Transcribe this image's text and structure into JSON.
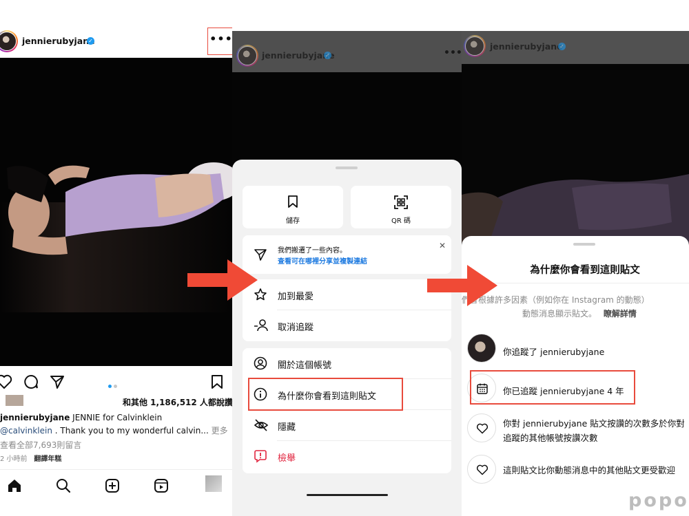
{
  "panel1": {
    "username": "jennierubyjane",
    "more_label": "•••",
    "likes_text": "和其他 1,186,512 人都說讚",
    "caption_user": "jennierubyjane",
    "caption_text": " JENNIE for Calvinklein",
    "mention": "@calvinklein",
    "caption_rest": " . Thank you to my wonderful calvin...",
    "more_link": "更多",
    "view_comments": "查看全部7,693則留言",
    "time_ago": "2 小時前",
    "translate": "翻譯年糕"
  },
  "panel2": {
    "username": "jennierubyjane",
    "tiles": [
      {
        "label": "儲存",
        "icon": "bookmark-icon"
      },
      {
        "label": "QR 碼",
        "icon": "qr-code-icon"
      }
    ],
    "notice": {
      "line1": "我們搬遷了一些內容。",
      "line2": "查看可在哪裡分享並複製連結",
      "close": "✕"
    },
    "group1": [
      {
        "label": "加到最愛",
        "icon": "star-icon"
      },
      {
        "label": "取消追蹤",
        "icon": "unfollow-icon"
      }
    ],
    "group2": [
      {
        "label": "關於這個帳號",
        "icon": "account-icon"
      },
      {
        "label": "為什麼你會看到這則貼文",
        "icon": "info-icon"
      },
      {
        "label": "隱藏",
        "icon": "hide-icon"
      },
      {
        "label": "檢舉",
        "icon": "report-icon"
      }
    ],
    "accent_danger": "#e1253f"
  },
  "panel3": {
    "username": "jennierubyjane",
    "title": "為什麼你會看到這則貼文",
    "desc_line1": "們會根據許多因素（例如你在 Instagram 的動態）",
    "desc_line2": "動態消息顯示貼文。",
    "learn_more": "瞭解詳情",
    "reasons": [
      {
        "text": "你追蹤了 jennierubyjane",
        "icon": "avatar"
      },
      {
        "text": "你已追蹤 jennierubyjane 4 年",
        "icon": "calendar-icon"
      },
      {
        "text": "你對 jennierubyjane 貼文按讚的次數多於你對",
        "text2": "追蹤的其他帳號按讚次數",
        "icon": "heart-icon"
      },
      {
        "text": "這則貼文比你動態消息中的其他貼文更受歡迎",
        "icon": "heart-icon"
      }
    ]
  },
  "watermark": "popo",
  "colors": {
    "highlight": "#e84a3c",
    "verified": "#1f9bf0",
    "link": "#1f7be0"
  }
}
